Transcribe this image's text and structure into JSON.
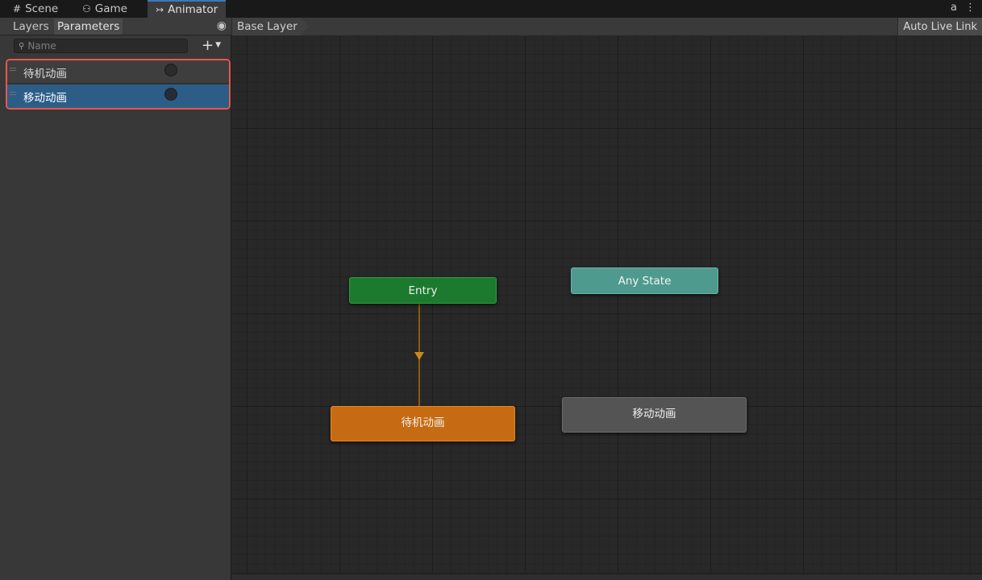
{
  "tabs": [
    {
      "icon": "#",
      "label": "Scene"
    },
    {
      "icon": "🎮",
      "label": "Game"
    },
    {
      "icon": "↣",
      "label": "Animator"
    }
  ],
  "tab_menu": {
    "lock": "🔒",
    "more": "⋮"
  },
  "left_panel": {
    "tabs": [
      "Layers",
      "Parameters"
    ],
    "active_tab": "Parameters",
    "search": {
      "placeholder": "Name",
      "value": ""
    },
    "add_button": "+",
    "parameters": [
      {
        "name": "待机动画",
        "type": "bool",
        "selected": false
      },
      {
        "name": "移动动画",
        "type": "bool",
        "selected": true
      }
    ]
  },
  "graph": {
    "breadcrumb": "Base Layer",
    "auto_live_link": "Auto Live Link",
    "nodes": {
      "entry": "Entry",
      "any_state": "Any State",
      "idle": "待机动画",
      "move": "移动动画"
    }
  },
  "colors": {
    "entry": "#1b7a2e",
    "any_state": "#4e9a8e",
    "default_state": "#c76b12",
    "state": "#545454",
    "selected_row": "#2c5d87",
    "highlight_box": "#e6574b"
  }
}
